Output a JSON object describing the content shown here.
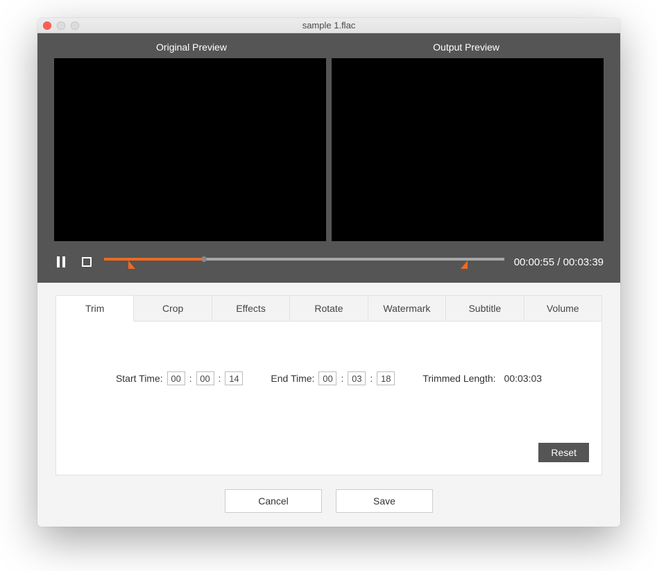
{
  "window": {
    "title": "sample 1.flac"
  },
  "preview": {
    "original_label": "Original Preview",
    "output_label": "Output  Preview"
  },
  "playback": {
    "current_time": "00:00:55",
    "total_time": "00:03:39",
    "time_separator": " / ",
    "progress_percent": 25,
    "trim_start_percent": 6.5,
    "trim_end_percent": 90.5
  },
  "tabs": {
    "items": [
      {
        "id": "trim",
        "label": "Trim",
        "active": true
      },
      {
        "id": "crop",
        "label": "Crop",
        "active": false
      },
      {
        "id": "effects",
        "label": "Effects",
        "active": false
      },
      {
        "id": "rotate",
        "label": "Rotate",
        "active": false
      },
      {
        "id": "watermark",
        "label": "Watermark",
        "active": false
      },
      {
        "id": "subtitle",
        "label": "Subtitle",
        "active": false
      },
      {
        "id": "volume",
        "label": "Volume",
        "active": false
      }
    ]
  },
  "trim": {
    "start_label": "Start Time:",
    "end_label": "End Time:",
    "length_label": "Trimmed Length:",
    "start": {
      "hh": "00",
      "mm": "00",
      "ss": "14"
    },
    "end": {
      "hh": "00",
      "mm": "03",
      "ss": "18"
    },
    "length_value": "00:03:03",
    "reset_label": "Reset"
  },
  "footer": {
    "cancel": "Cancel",
    "save": "Save"
  },
  "colors": {
    "accent": "#ef6a1f",
    "upper_bg": "#555555"
  }
}
